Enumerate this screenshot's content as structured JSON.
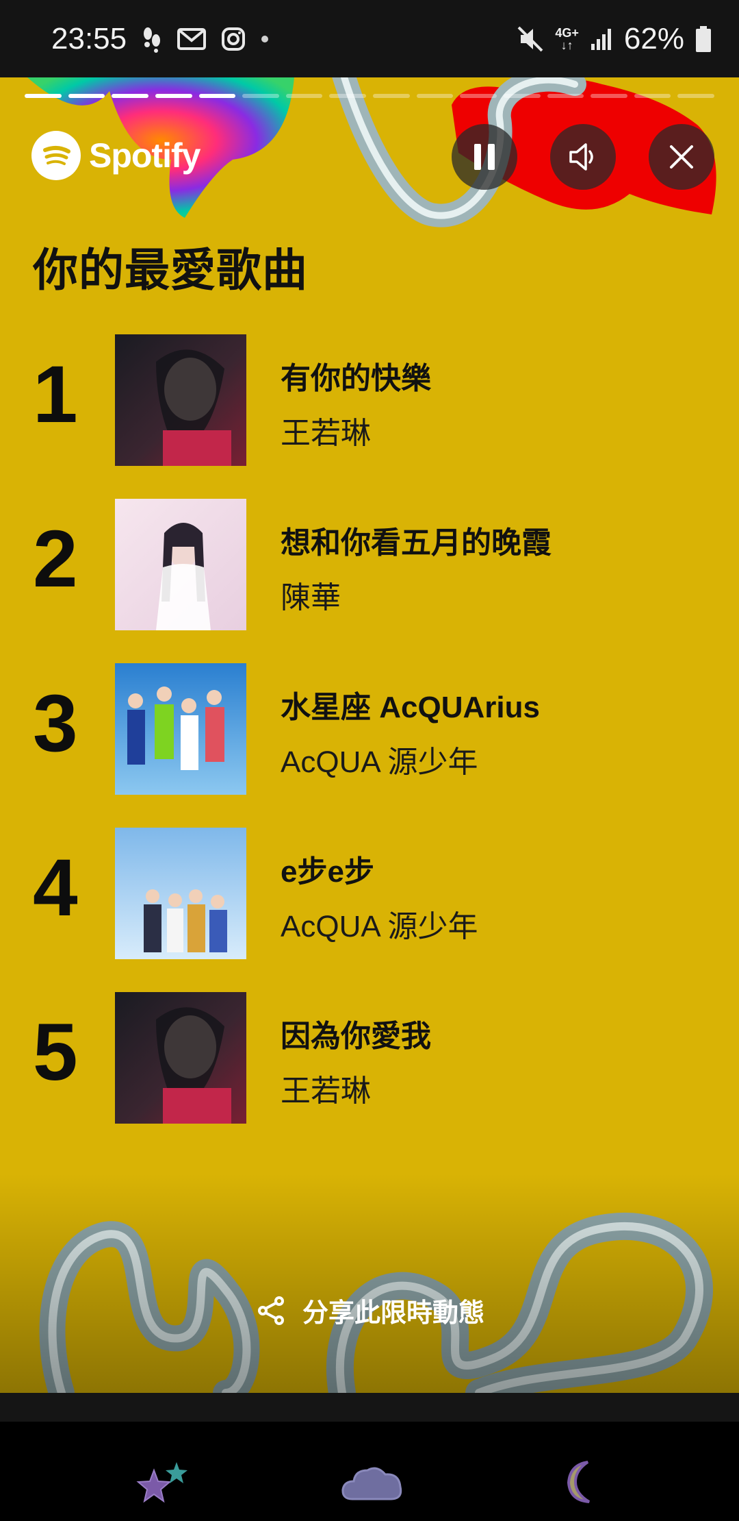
{
  "status_bar": {
    "time": "23:55",
    "network": "4G+",
    "battery": "62%",
    "icons": [
      "footsteps-icon",
      "gmail-icon",
      "instagram-icon",
      "dot-icon",
      "mute-icon",
      "network-icon",
      "signal-icon",
      "battery-icon"
    ]
  },
  "story": {
    "brand": "Spotify",
    "progress": {
      "segments": 16,
      "completed": 5
    },
    "controls": [
      "pause-icon",
      "volume-icon",
      "close-icon"
    ],
    "title": "你的最愛歌曲",
    "tracks": [
      {
        "rank": "1",
        "song": "有你的快樂",
        "artist": "王若琳"
      },
      {
        "rank": "2",
        "song": "想和你看五月的晚霞",
        "artist": "陳華"
      },
      {
        "rank": "3",
        "song": "水星座 AcQUArius",
        "artist": "AcQUA 源少年"
      },
      {
        "rank": "4",
        "song": "e步e步",
        "artist": "AcQUA 源少年"
      },
      {
        "rank": "5",
        "song": "因為你愛我",
        "artist": "王若琳"
      }
    ],
    "share_label": "分享此限時動態",
    "background_color": "#d9b305"
  },
  "nav": {
    "icons": [
      "stars-icon",
      "cloud-icon",
      "moon-icon"
    ]
  }
}
